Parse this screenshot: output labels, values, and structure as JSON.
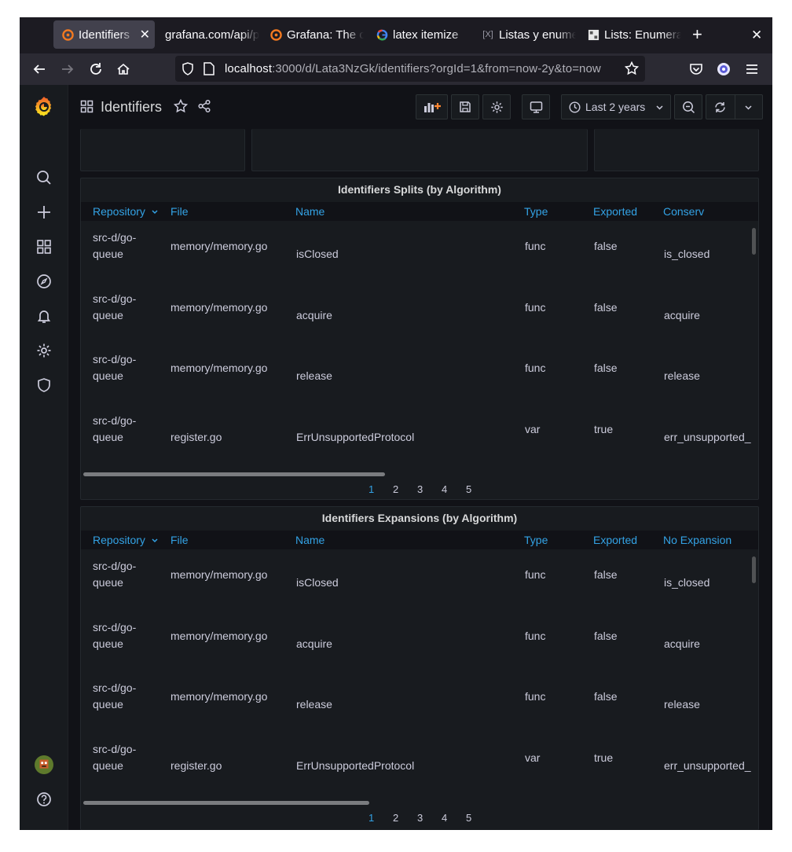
{
  "browser": {
    "tabs": [
      {
        "label": "Identifiers",
        "active": true,
        "favicon": "grafana-logo-icon"
      },
      {
        "label": "grafana.com/api/plugins",
        "active": false,
        "favicon": ""
      },
      {
        "label": "Grafana: The open",
        "active": false,
        "favicon": "grafana-logo-icon"
      },
      {
        "label": "latex itemize",
        "active": false,
        "favicon": "google-g-icon"
      },
      {
        "label": "Listas y enumeraciones",
        "active": false,
        "favicon": "latex-icon"
      },
      {
        "label": "Lists: Enumerate",
        "active": false,
        "favicon": "overleaf-icon"
      }
    ],
    "url_host": "localhost",
    "url_path": ":3000/d/Lata3NzGk/identifiers?orgId=1&from=now-2y&to=now"
  },
  "dashboard": {
    "title": "Identifiers",
    "time_range": "Last 2 years"
  },
  "panels": [
    {
      "title": "Identifiers Splits (by Algorithm)",
      "columns": [
        "Repository",
        "File",
        "Name",
        "Type",
        "Exported",
        "Conserv"
      ],
      "rows": [
        {
          "repo1": "src-d/go-",
          "repo2": "queue",
          "file": "memory/memory.go",
          "name": "isClosed",
          "type": "func",
          "exported": "false",
          "last": "is_closed"
        },
        {
          "repo1": "src-d/go-",
          "repo2": "queue",
          "file": "memory/memory.go",
          "name": "acquire",
          "type": "func",
          "exported": "false",
          "last": "acquire"
        },
        {
          "repo1": "src-d/go-",
          "repo2": "queue",
          "file": "memory/memory.go",
          "name": "release",
          "type": "func",
          "exported": "false",
          "last": "release"
        },
        {
          "repo1": "src-d/go-",
          "repo2": "queue",
          "file": "register.go",
          "name": "ErrUnsupportedProtocol",
          "type": "var",
          "exported": "true",
          "last": "err_unsupported_"
        }
      ],
      "pages": [
        "1",
        "2",
        "3",
        "4",
        "5"
      ],
      "current_page": "1"
    },
    {
      "title": "Identifiers Expansions (by Algorithm)",
      "columns": [
        "Repository",
        "File",
        "Name",
        "Type",
        "Exported",
        "No Expansion"
      ],
      "rows": [
        {
          "repo1": "src-d/go-",
          "repo2": "queue",
          "file": "memory/memory.go",
          "name": "isClosed",
          "type": "func",
          "exported": "false",
          "last": "is_closed"
        },
        {
          "repo1": "src-d/go-",
          "repo2": "queue",
          "file": "memory/memory.go",
          "name": "acquire",
          "type": "func",
          "exported": "false",
          "last": "acquire"
        },
        {
          "repo1": "src-d/go-",
          "repo2": "queue",
          "file": "memory/memory.go",
          "name": "release",
          "type": "func",
          "exported": "false",
          "last": "release"
        },
        {
          "repo1": "src-d/go-",
          "repo2": "queue",
          "file": "register.go",
          "name": "ErrUnsupportedProtocol",
          "type": "var",
          "exported": "true",
          "last": "err_unsupported_"
        }
      ],
      "pages": [
        "1",
        "2",
        "3",
        "4",
        "5"
      ],
      "current_page": "1"
    }
  ],
  "colors": {
    "accent": "#33a2e5",
    "grafana_orange": "#f05a28",
    "background": "#111217",
    "panel": "#181b1f"
  }
}
